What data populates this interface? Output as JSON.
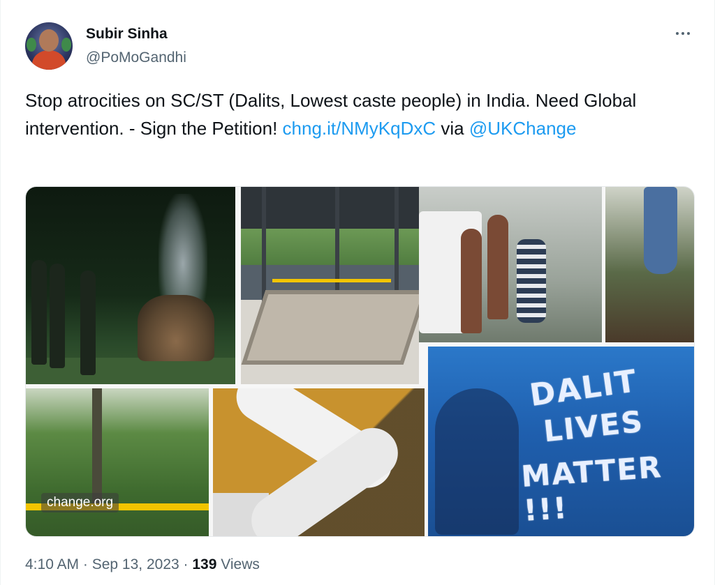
{
  "author": {
    "name": "Subir Sinha",
    "handle": "@PoMoGandhi"
  },
  "more_icon": "more-horizontal-icon",
  "tweet": {
    "text_part1": "Stop atrocities on SC/ST (Dalits, Lowest caste people) in India. Need Global intervention. - Sign the Petition! ",
    "link": "chng.it/NMyKqDxC",
    "text_part2": " via ",
    "mention": "@UKChange"
  },
  "media": {
    "watermark": "change.org",
    "sign_words": [
      "DALIT",
      "LIVES",
      "MATTER !!!"
    ]
  },
  "meta": {
    "time": "4:10 AM",
    "separator1": " · ",
    "date": "Sep 13, 2023",
    "separator2": " · ",
    "views_count": "139",
    "views_label": " Views"
  },
  "colors": {
    "link": "#1d9bf0",
    "secondary_text": "#536471",
    "primary_text": "#0f1419"
  }
}
